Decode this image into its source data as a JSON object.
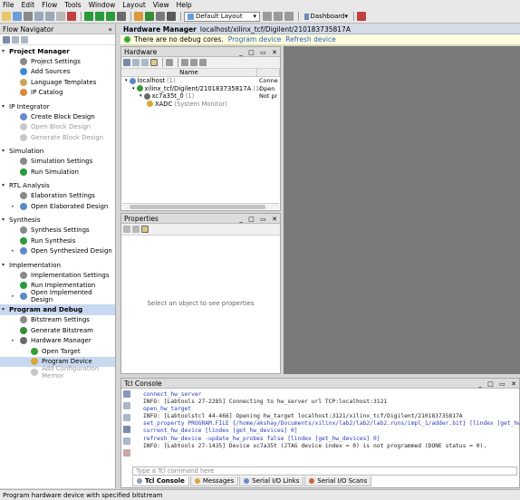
{
  "menu": [
    "File",
    "Edit",
    "Flow",
    "Tools",
    "Window",
    "Layout",
    "View",
    "Help"
  ],
  "toolbar": {
    "layout_select": "Default Layout",
    "dashboard_label": "Dashboard"
  },
  "flow_navigator": {
    "title": "Flow Navigator",
    "collapse_glyph": "«",
    "sections": [
      {
        "title": "Project Manager",
        "bold": true,
        "items": [
          {
            "label": "Project Settings",
            "icon": "gear-icon",
            "disabled": false
          },
          {
            "label": "Add Sources",
            "icon": "add-icon",
            "disabled": false
          },
          {
            "label": "Language Templates",
            "icon": "document-icon",
            "disabled": false
          },
          {
            "label": "IP Catalog",
            "icon": "ip-icon",
            "disabled": false
          }
        ]
      },
      {
        "title": "IP Integrator",
        "bold": false,
        "items": [
          {
            "label": "Create Block Design",
            "icon": "block-icon",
            "disabled": false
          },
          {
            "label": "Open Block Design",
            "icon": "block-icon",
            "disabled": true
          },
          {
            "label": "Generate Block Design",
            "icon": "block-icon",
            "disabled": true
          }
        ]
      },
      {
        "title": "Simulation",
        "bold": false,
        "items": [
          {
            "label": "Simulation Settings",
            "icon": "gear-icon",
            "disabled": false
          },
          {
            "label": "Run Simulation",
            "icon": "play-icon",
            "disabled": false
          }
        ]
      },
      {
        "title": "RTL Analysis",
        "bold": false,
        "items": [
          {
            "label": "Elaboration Settings",
            "icon": "gear-icon",
            "disabled": false
          },
          {
            "label": "Open Elaborated Design",
            "icon": "design-icon",
            "disabled": false,
            "expandable": true
          }
        ]
      },
      {
        "title": "Synthesis",
        "bold": false,
        "items": [
          {
            "label": "Synthesis Settings",
            "icon": "gear-icon",
            "disabled": false
          },
          {
            "label": "Run Synthesis",
            "icon": "play-icon",
            "disabled": false
          },
          {
            "label": "Open Synthesized Design",
            "icon": "design-icon",
            "disabled": false,
            "expandable": true
          }
        ]
      },
      {
        "title": "Implementation",
        "bold": false,
        "items": [
          {
            "label": "Implementation Settings",
            "icon": "gear-icon",
            "disabled": false
          },
          {
            "label": "Run Implementation",
            "icon": "play-icon",
            "disabled": false
          },
          {
            "label": "Open Implemented Design",
            "icon": "design-icon",
            "disabled": false,
            "expandable": true
          }
        ]
      },
      {
        "title": "Program and Debug",
        "bold": true,
        "highlight": true,
        "items": [
          {
            "label": "Bitstream Settings",
            "icon": "gear-icon",
            "disabled": false
          },
          {
            "label": "Generate Bitstream",
            "icon": "bitstream-icon",
            "disabled": false
          },
          {
            "label": "Hardware Manager",
            "icon": "chip-icon",
            "disabled": false,
            "expandable": true
          },
          {
            "label": "Open Target",
            "icon": "target-icon",
            "disabled": false,
            "sub": true
          },
          {
            "label": "Program Device",
            "icon": "program-icon",
            "disabled": false,
            "sub": true,
            "selected": true
          },
          {
            "label": "Add Configuration Memor",
            "icon": "memory-icon",
            "disabled": true,
            "sub": true
          }
        ]
      }
    ]
  },
  "hardware_manager": {
    "title": "Hardware Manager",
    "path": "localhost/xilinx_tcf/Digilent/210183735817A",
    "debug_message": "There are no debug cores.",
    "link_program": "Program device",
    "link_refresh": "Refresh device"
  },
  "hardware_panel": {
    "title": "Hardware",
    "column_name": "Name",
    "rows": [
      {
        "name": "localhost",
        "count": "(1)",
        "status": "Conne",
        "indent": 0
      },
      {
        "name": "xilinx_tcf/Digilent/210183735817A",
        "count": "(1)",
        "status": "Open",
        "indent": 1
      },
      {
        "name": "xc7a35t_0",
        "count": "(1)",
        "status": "Not pr",
        "indent": 2
      },
      {
        "name": "XADC",
        "count": "(System Monitor)",
        "status": "",
        "indent": 3
      }
    ]
  },
  "properties": {
    "title": "Properties",
    "empty_message": "Select an object to see properties"
  },
  "tcl_console": {
    "title": "Tcl Console",
    "lines": [
      {
        "text": "connect_hw_server",
        "kind": "cmd"
      },
      {
        "text": "INFO: [Labtools 27-2285] Connecting to hw_server url TCP:localhost:3121",
        "kind": "out"
      },
      {
        "text": "open_hw_target",
        "kind": "cmd"
      },
      {
        "text": "INFO: [Labtoolstcl 44-466] Opening hw_target localhost:3121/xilinx_tcf/Digilent/210183735817A",
        "kind": "out"
      },
      {
        "text": "set_property PROGRAM.FILE {/home/akshay/Documents/xilinx/lab2/lab2/lab2.runs/impl_1/adder.bit} [lindex [get_hw_de",
        "kind": "cmd"
      },
      {
        "text": "current_hw_device [lindex [get_hw_devices] 0]",
        "kind": "cmd"
      },
      {
        "text": "refresh_hw_device -update_hw_probes false [lindex [get_hw_devices] 0]",
        "kind": "cmd"
      },
      {
        "text": "INFO: [Labtools 27-1435] Device xc7a35t (JTAG device index = 0) is not programmed (DONE status = 0).",
        "kind": "out"
      }
    ],
    "input_placeholder": "Type a Tcl command here",
    "tabs": [
      "Tcl Console",
      "Messages",
      "Serial I/O Links",
      "Serial I/O Scans"
    ]
  },
  "status_bar": "Program hardware device with specified bitstream",
  "colors": {
    "accent_blue": "#2a5cb8",
    "selection": "#c8d8f0",
    "gray_area": "#7a7a7a",
    "debug_bg": "#ffffe0"
  }
}
